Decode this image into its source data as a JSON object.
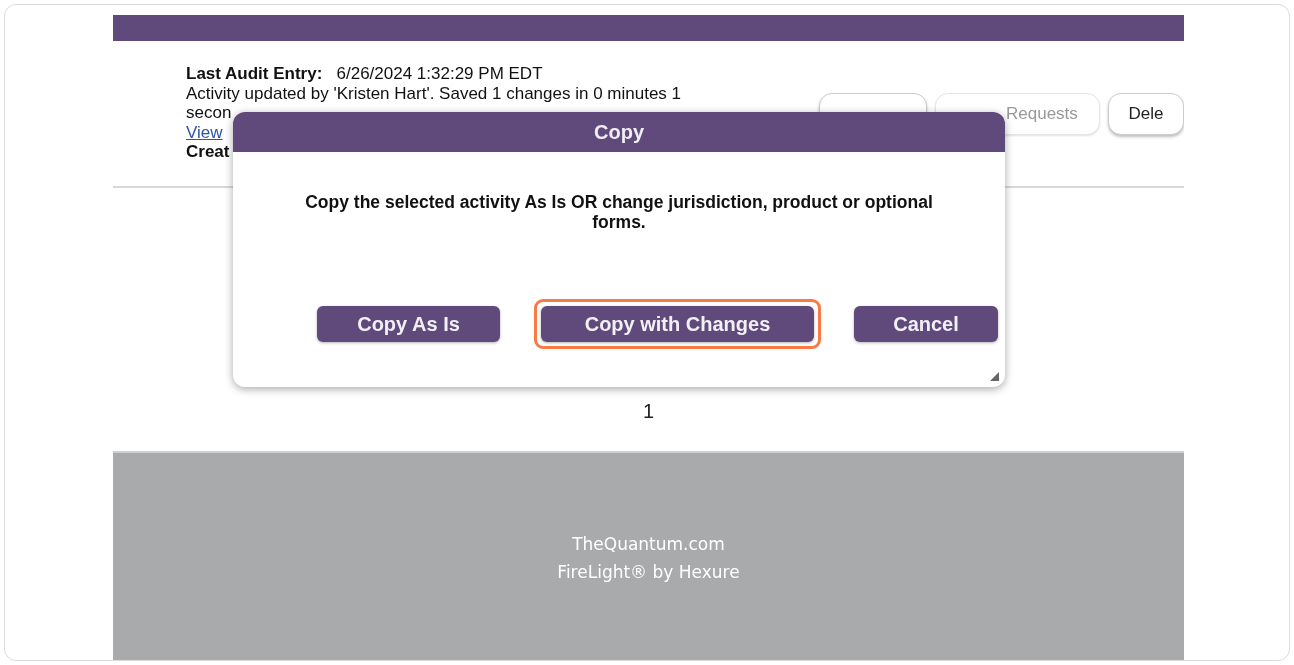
{
  "audit": {
    "label": "Last Audit Entry:",
    "timestamp": "6/26/2024 1:32:29 PM EDT",
    "message": "Activity updated by 'Kristen Hart'. Saved 1 changes in 0 minutes 1",
    "message_cont": "secon",
    "link": "View",
    "created": "Creat"
  },
  "action_buttons": [
    {
      "disabled": false
    },
    {
      "label": "Requests",
      "disabled": true
    },
    {
      "label": "Dele",
      "disabled": false
    }
  ],
  "pagination": {
    "page": "1"
  },
  "footer": {
    "lines": [
      "TheQuantum.com",
      "FireLight® by Hexure"
    ]
  },
  "dialog": {
    "title": "Copy",
    "message": "Copy the selected activity As Is OR change jurisdiction, product or optional forms.",
    "buttons": [
      {
        "label": "Copy As Is",
        "highlighted": false
      },
      {
        "label": "Copy with Changes",
        "highlighted": true
      },
      {
        "label": "Cancel",
        "highlighted": false
      }
    ]
  }
}
